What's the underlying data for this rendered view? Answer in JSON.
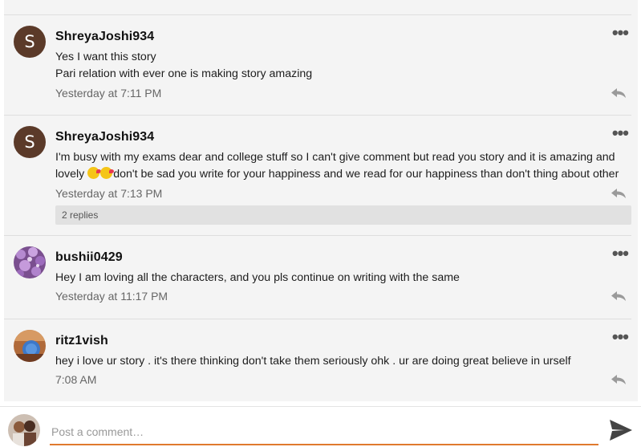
{
  "comments": [
    {
      "username": "ShreyaJoshi934",
      "avatar_letter": "S",
      "lines": [
        "Yes I want this story",
        "Pari relation with ever one is making story amazing"
      ],
      "time": "Yesterday at 7:11 PM"
    },
    {
      "username": "ShreyaJoshi934",
      "avatar_letter": "S",
      "lines": [
        "I'm busy with my exams dear and college stuff so I can't give comment but read you story and it is amazing and",
        "don't be sad you write for your happiness and we read for our happiness than don't thing about other"
      ],
      "line2_prefix": "lovely ",
      "time": "Yesterday at 7:13 PM",
      "replies_label": "2 replies"
    },
    {
      "username": "bushii0429",
      "lines": [
        "Hey I am loving all the characters, and you pls continue on writing with the same"
      ],
      "time": "Yesterday at 11:17 PM"
    },
    {
      "username": "ritz1vish",
      "lines": [
        "hey i love ur story . it's there thinking don't take them seriously ohk . ur are doing great believe in urself"
      ],
      "time": "7:08 AM"
    }
  ],
  "icons": {
    "more": "more-options-icon",
    "reply": "reply-icon",
    "send": "send-icon"
  },
  "composer": {
    "placeholder": "Post a comment…"
  },
  "colors": {
    "accent": "#e07a2e",
    "avatar_brown": "#5b3a29",
    "feed_bg": "#f4f4f4"
  }
}
